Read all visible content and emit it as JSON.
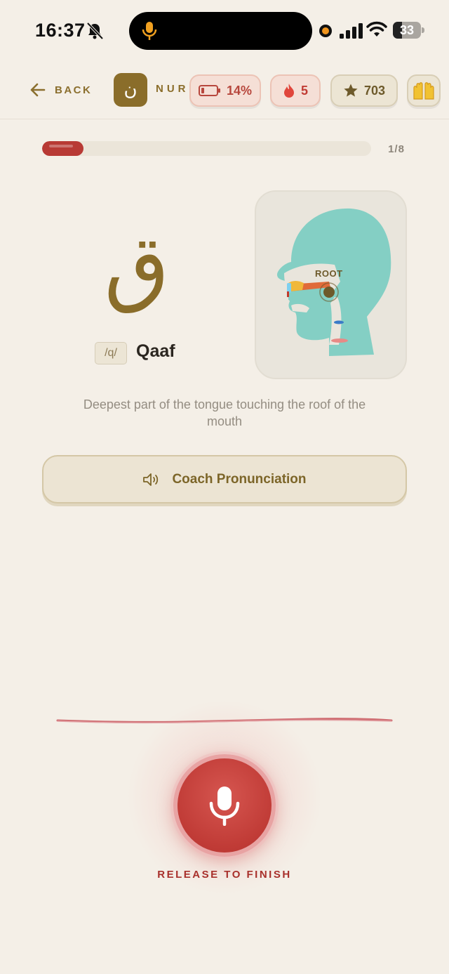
{
  "status_bar": {
    "time": "16:37",
    "battery_level": "33",
    "icons": [
      "bell-slash-icon",
      "microphone-icon",
      "recording-dot-icon",
      "cellular-signal-icon",
      "wifi-icon",
      "battery-icon"
    ]
  },
  "header": {
    "back_label": "BACK",
    "logo_glyph": "ن",
    "brand_text": "NUR",
    "battery_pill": "14%",
    "streak_pill": "5",
    "stars_pill": "703",
    "icons": [
      "arrow-left-icon",
      "battery-low-icon",
      "flame-icon",
      "star-icon",
      "raised-hands-icon"
    ]
  },
  "progress": {
    "current": 1,
    "total": 8,
    "label": "1/8"
  },
  "letter": {
    "arabic": "ق",
    "ipa": "/q/",
    "name": "Qaaf"
  },
  "diagram": {
    "label": "ROOT"
  },
  "description": "Deepest part of the tongue touching the roof of the mouth",
  "coach_button": {
    "label": "Coach Pronunciation",
    "icon": "speaker-icon"
  },
  "record": {
    "label": "RELEASE TO FINISH",
    "icon": "microphone-icon"
  },
  "colors": {
    "background": "#f4efe7",
    "gold": "#8a6d2a",
    "accent_red": "#c03b36",
    "diagram_teal": "#84cfc4"
  }
}
